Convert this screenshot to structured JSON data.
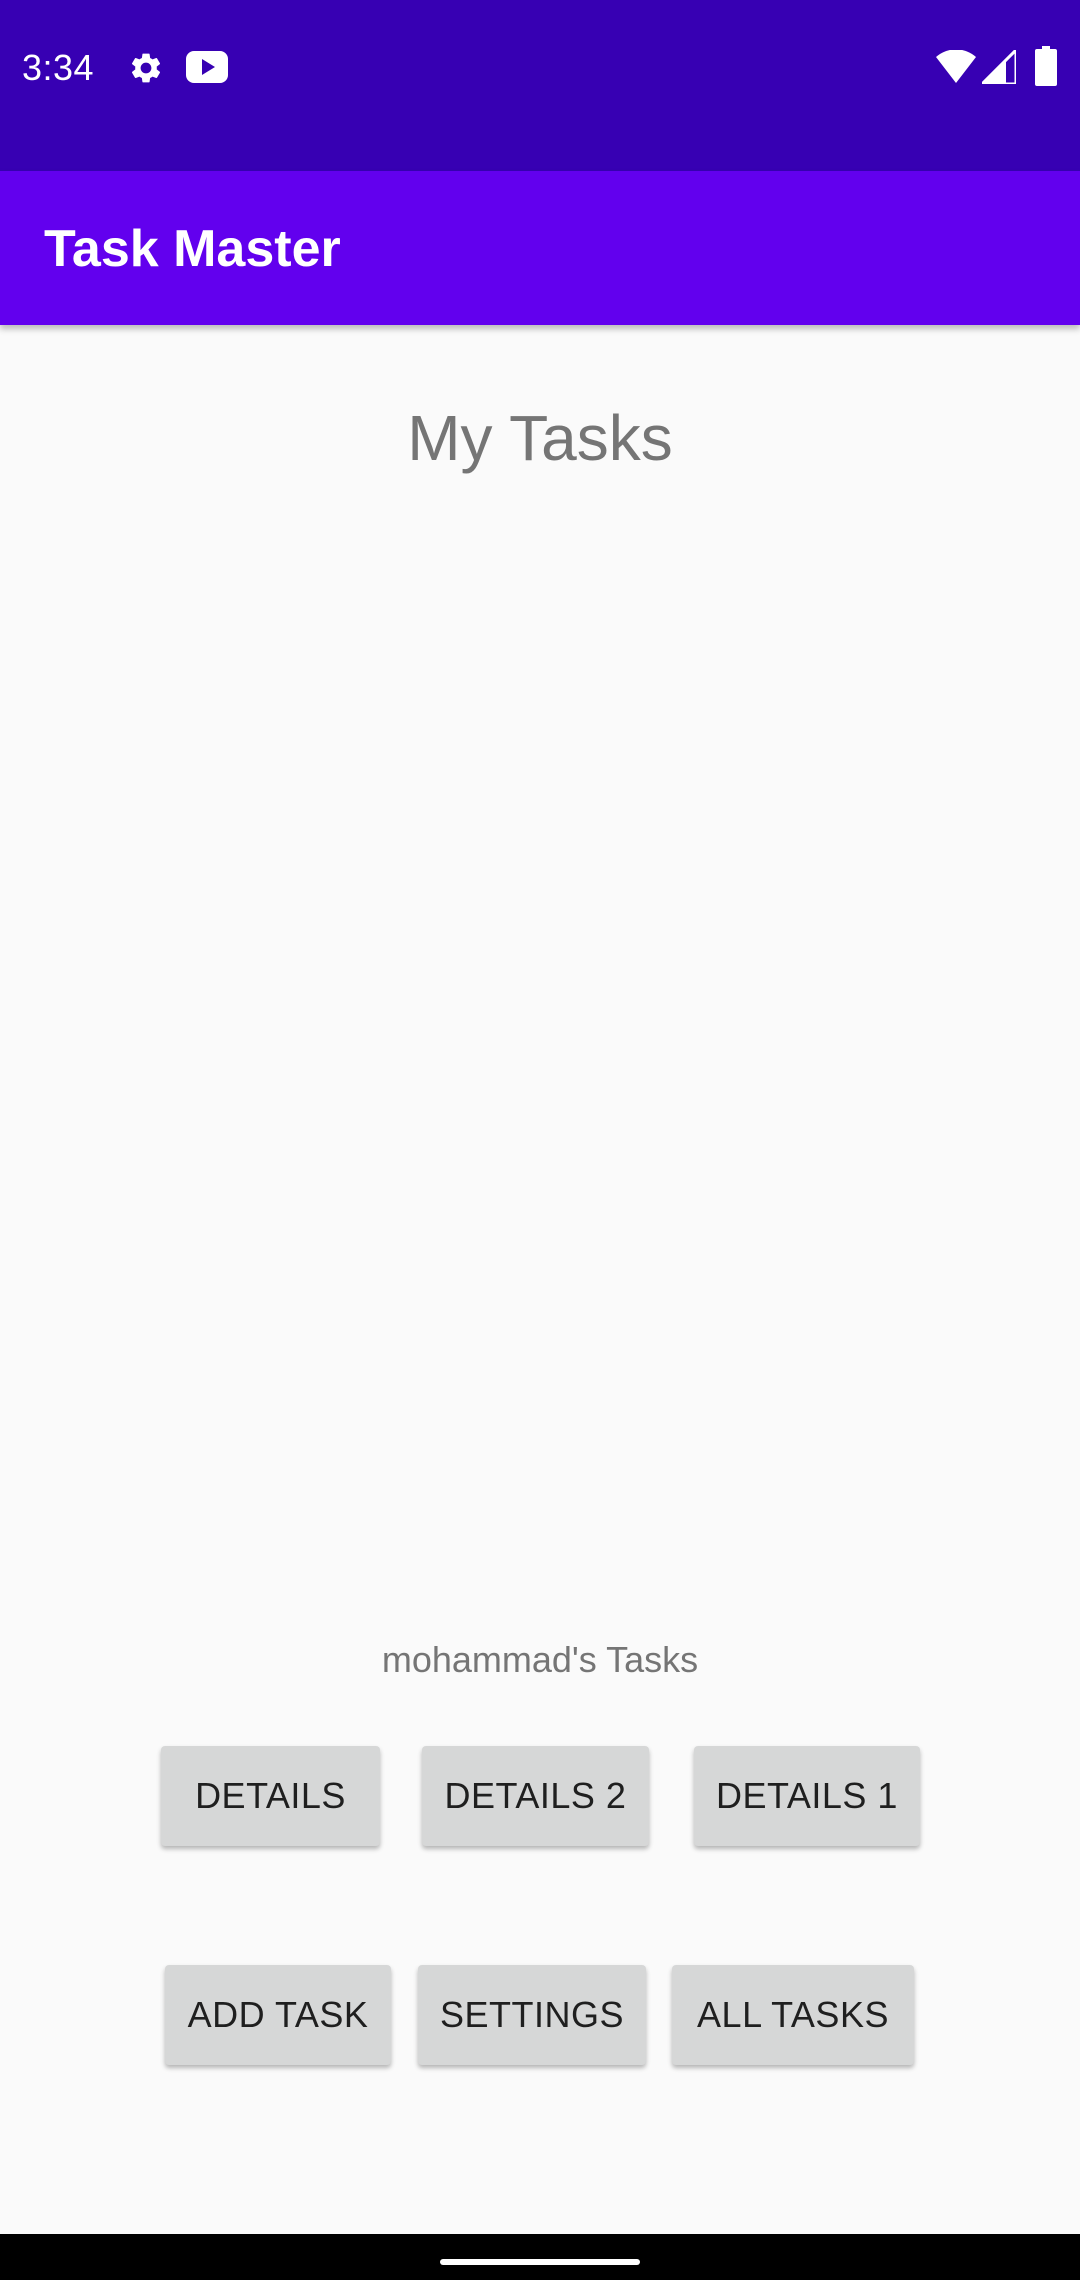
{
  "status_bar": {
    "time": "3:34",
    "left_icons": [
      "gear-icon",
      "youtube-icon"
    ],
    "right_icons": [
      "wifi-icon",
      "cell-signal-icon",
      "battery-icon"
    ]
  },
  "app_bar": {
    "title": "Task Master"
  },
  "main": {
    "title": "My Tasks",
    "user_tasks_label": "mohammad's Tasks"
  },
  "buttons": {
    "row1": [
      "DETAILS",
      "DETAILS 2",
      "DETAILS 1"
    ],
    "row2": [
      "ADD TASK",
      "SETTINGS",
      "ALL TASKS"
    ]
  },
  "colors": {
    "status_bar": "#3700B3",
    "app_bar": "#6200EE",
    "background": "#FAFAFA",
    "button": "#D6D7D7"
  }
}
